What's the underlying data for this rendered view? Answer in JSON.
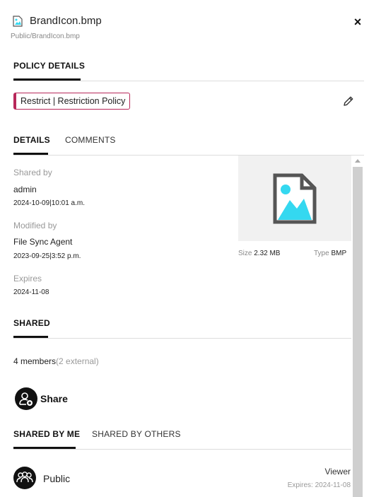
{
  "header": {
    "file_name": "BrandIcon.bmp",
    "file_path": "Public/BrandIcon.bmp",
    "close_symbol": "×"
  },
  "policy_tabs": [
    {
      "label": "POLICY DETAILS",
      "active": true
    }
  ],
  "policy": {
    "badge": "Restrict | Restriction Policy",
    "badge_color": "#b8285a"
  },
  "detail_tabs": [
    {
      "label": "DETAILS",
      "active": true
    },
    {
      "label": "COMMENTS",
      "active": false
    }
  ],
  "details": {
    "shared_by_label": "Shared by",
    "shared_by": "admin",
    "shared_date": "2024-10-09|10:01 a.m.",
    "modified_by_label": "Modified by",
    "modified_by": "File Sync Agent",
    "modified_date": "2023-09-25|3:52 p.m.",
    "expires_label": "Expires",
    "expires": "2024-11-08"
  },
  "preview": {
    "icon": "image-file-icon",
    "accent": "#34d8f0",
    "size_label": "Size",
    "size": "2.32 MB",
    "type_label": "Type",
    "type": "BMP"
  },
  "shared_section": {
    "tab": "SHARED",
    "members": "4 members",
    "external": "(2 external)",
    "share_label": "Share"
  },
  "share_tabs": [
    {
      "label": "SHARED BY ME",
      "active": true
    },
    {
      "label": "SHARED BY OTHERS",
      "active": false
    }
  ],
  "share_rows": [
    {
      "name": "Public",
      "role": "Viewer",
      "expires": "Expires: 2024-11-08",
      "icon": "group-icon"
    }
  ]
}
